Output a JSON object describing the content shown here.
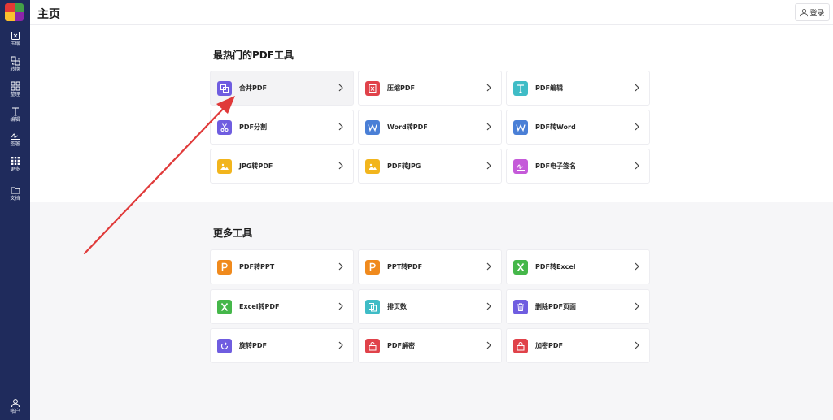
{
  "sidebar": {
    "logo_colors": [
      "#e53935",
      "#43a047",
      "#fbc02d",
      "#8e24aa"
    ],
    "items": [
      {
        "label": "压缩",
        "icon": "compress-icon"
      },
      {
        "label": "转换",
        "icon": "convert-icon"
      },
      {
        "label": "整理",
        "icon": "organize-icon"
      },
      {
        "label": "编辑",
        "icon": "edit-text-icon"
      },
      {
        "label": "签署",
        "icon": "sign-icon"
      },
      {
        "label": "更多",
        "icon": "more-grid-icon"
      },
      {
        "label": "文档",
        "icon": "folder-icon"
      }
    ],
    "account_label": "帐户"
  },
  "header": {
    "title": "主页",
    "login_label": "登录"
  },
  "hot_section": {
    "title": "最热门的PDF工具",
    "tools": [
      {
        "name": "合并PDF",
        "icon": "merge-icon",
        "color": "#6f5de0"
      },
      {
        "name": "压缩PDF",
        "icon": "compress-icon",
        "color": "#e0424a"
      },
      {
        "name": "PDF编辑",
        "icon": "text-edit-icon",
        "color": "#3fbcc6"
      },
      {
        "name": "PDF分割",
        "icon": "scissors-icon",
        "color": "#6f5de0"
      },
      {
        "name": "Word转PDF",
        "icon": "word-icon",
        "color": "#4a7fd6"
      },
      {
        "name": "PDF转Word",
        "icon": "word-icon",
        "color": "#4a7fd6"
      },
      {
        "name": "JPG转PDF",
        "icon": "image-icon",
        "color": "#f2b51d"
      },
      {
        "name": "PDF转JPG",
        "icon": "image-icon",
        "color": "#f2b51d"
      },
      {
        "name": "PDF电子签名",
        "icon": "signature-icon",
        "color": "#c55ad9"
      }
    ]
  },
  "more_section": {
    "title": "更多工具",
    "tools": [
      {
        "name": "PDF转PPT",
        "icon": "ppt-icon",
        "color": "#f08a1d"
      },
      {
        "name": "PPT转PDF",
        "icon": "ppt-icon",
        "color": "#f08a1d"
      },
      {
        "name": "PDF转Excel",
        "icon": "excel-icon",
        "color": "#45b74a"
      },
      {
        "name": "Excel转PDF",
        "icon": "excel-icon",
        "color": "#45b74a"
      },
      {
        "name": "排页数",
        "icon": "page-number-icon",
        "color": "#3fbcc6"
      },
      {
        "name": "删除PDF页面",
        "icon": "trash-icon",
        "color": "#6f5de0"
      },
      {
        "name": "旋转PDF",
        "icon": "rotate-icon",
        "color": "#6f5de0"
      },
      {
        "name": "PDF解密",
        "icon": "unlock-icon",
        "color": "#e0424a"
      },
      {
        "name": "加密PDF",
        "icon": "lock-icon",
        "color": "#e0424a"
      }
    ]
  },
  "annotation": {
    "color": "#e03a3a"
  }
}
